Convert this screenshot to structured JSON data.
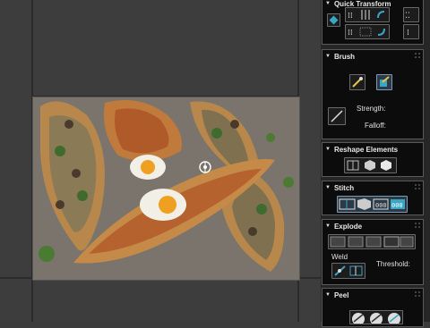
{
  "panels": {
    "quick_transform": {
      "title": "Quick Transform"
    },
    "brush": {
      "title": "Brush",
      "strength_label": "Strength:",
      "falloff_label": "Falloff:"
    },
    "reshape": {
      "title": "Reshape Elements"
    },
    "stitch": {
      "title": "Stitch"
    },
    "explode": {
      "title": "Explode",
      "weld_label": "Weld",
      "threshold_label": "Threshold:"
    },
    "peel": {
      "title": "Peel"
    }
  },
  "viewport": {
    "image": "pide-flatbread-photo"
  },
  "colors": {
    "accent": "#38a6c4",
    "panel_bg": "#0c0c0c",
    "viewport_bg": "#3d3d3d"
  }
}
